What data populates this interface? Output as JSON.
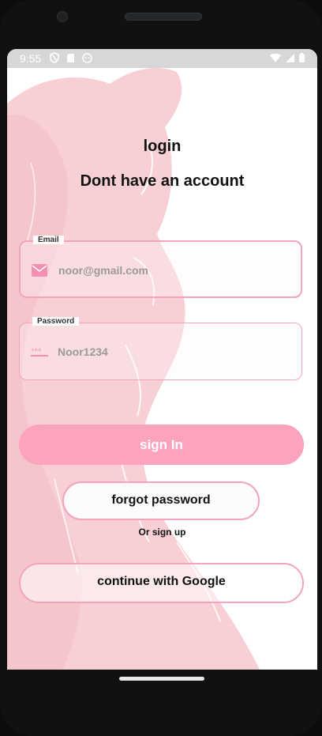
{
  "status_bar": {
    "time": "9:55",
    "left_icons": [
      "shield-icon",
      "sd-card-icon",
      "android-icon"
    ],
    "right_icons": [
      "wifi-icon",
      "signal-icon",
      "battery-icon"
    ]
  },
  "login": {
    "heading": "login",
    "subheading": "Dont have an account"
  },
  "email": {
    "label": "Email",
    "value": "noor@gmail.com",
    "icon": "mail-icon"
  },
  "password": {
    "label": "Password",
    "value": "Noor1234",
    "icon": "password-dots-icon"
  },
  "buttons": {
    "sign_in": "sign In",
    "forgot_password": "forgot password",
    "or_sign_up": "Or sign up",
    "google": "continue with Google"
  },
  "colors": {
    "accent_pink": "#fca3be",
    "border_pink": "#f4a3bd",
    "background_art": "#f7cfd4"
  }
}
